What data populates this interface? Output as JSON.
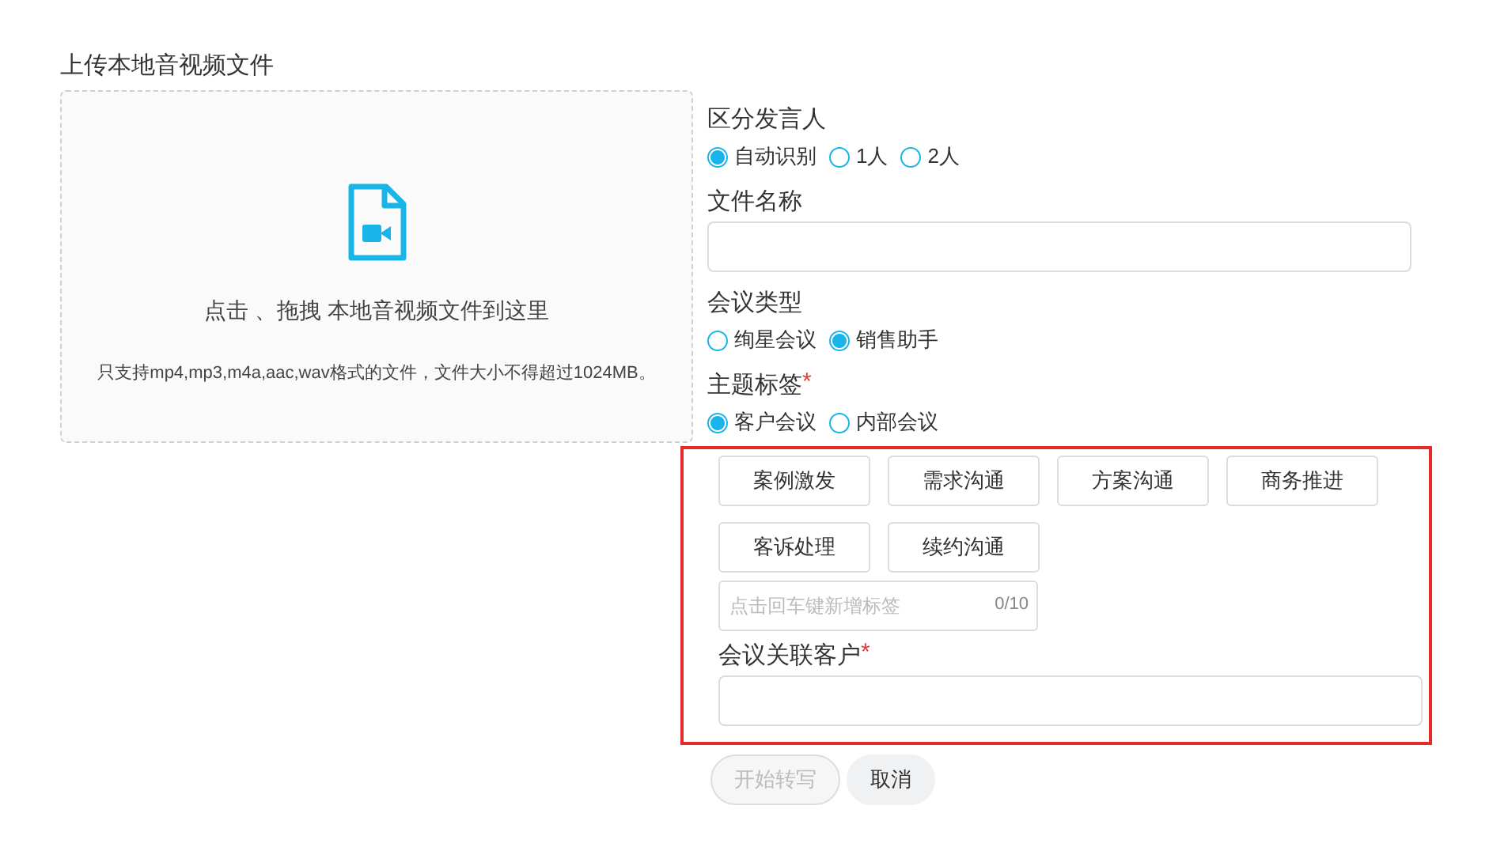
{
  "upload": {
    "title": "上传本地音视频文件",
    "prompt": "点击 、拖拽 本地音视频文件到这里",
    "hint": "只支持mp4,mp3,m4a,aac,wav格式的文件，文件大小不得超过1024MB。"
  },
  "speaker": {
    "label": "区分发言人",
    "options": [
      {
        "label": "自动识别",
        "selected": true
      },
      {
        "label": "1人",
        "selected": false
      },
      {
        "label": "2人",
        "selected": false
      }
    ]
  },
  "file_name": {
    "label": "文件名称"
  },
  "meeting_type": {
    "label": "会议类型",
    "options": [
      {
        "label": "绚星会议",
        "selected": false
      },
      {
        "label": "销售助手",
        "selected": true
      }
    ]
  },
  "topic": {
    "label": "主题标签",
    "required_mark": "*",
    "options": [
      {
        "label": "客户会议",
        "selected": true
      },
      {
        "label": "内部会议",
        "selected": false
      }
    ]
  },
  "tag_panel": {
    "highlighted": true,
    "tags": [
      "案例激发",
      "需求沟通",
      "方案沟通",
      "商务推进",
      "客诉处理",
      "续约沟通"
    ],
    "new_tag": {
      "placeholder": "点击回车键新增标签",
      "counter": "0/10"
    },
    "customer": {
      "label": "会议关联客户",
      "required_mark": "*"
    }
  },
  "buttons": [
    {
      "label": "开始转写",
      "kind": "primary",
      "disabled": true
    },
    {
      "label": "取消",
      "kind": "secondary",
      "disabled": false
    }
  ]
}
